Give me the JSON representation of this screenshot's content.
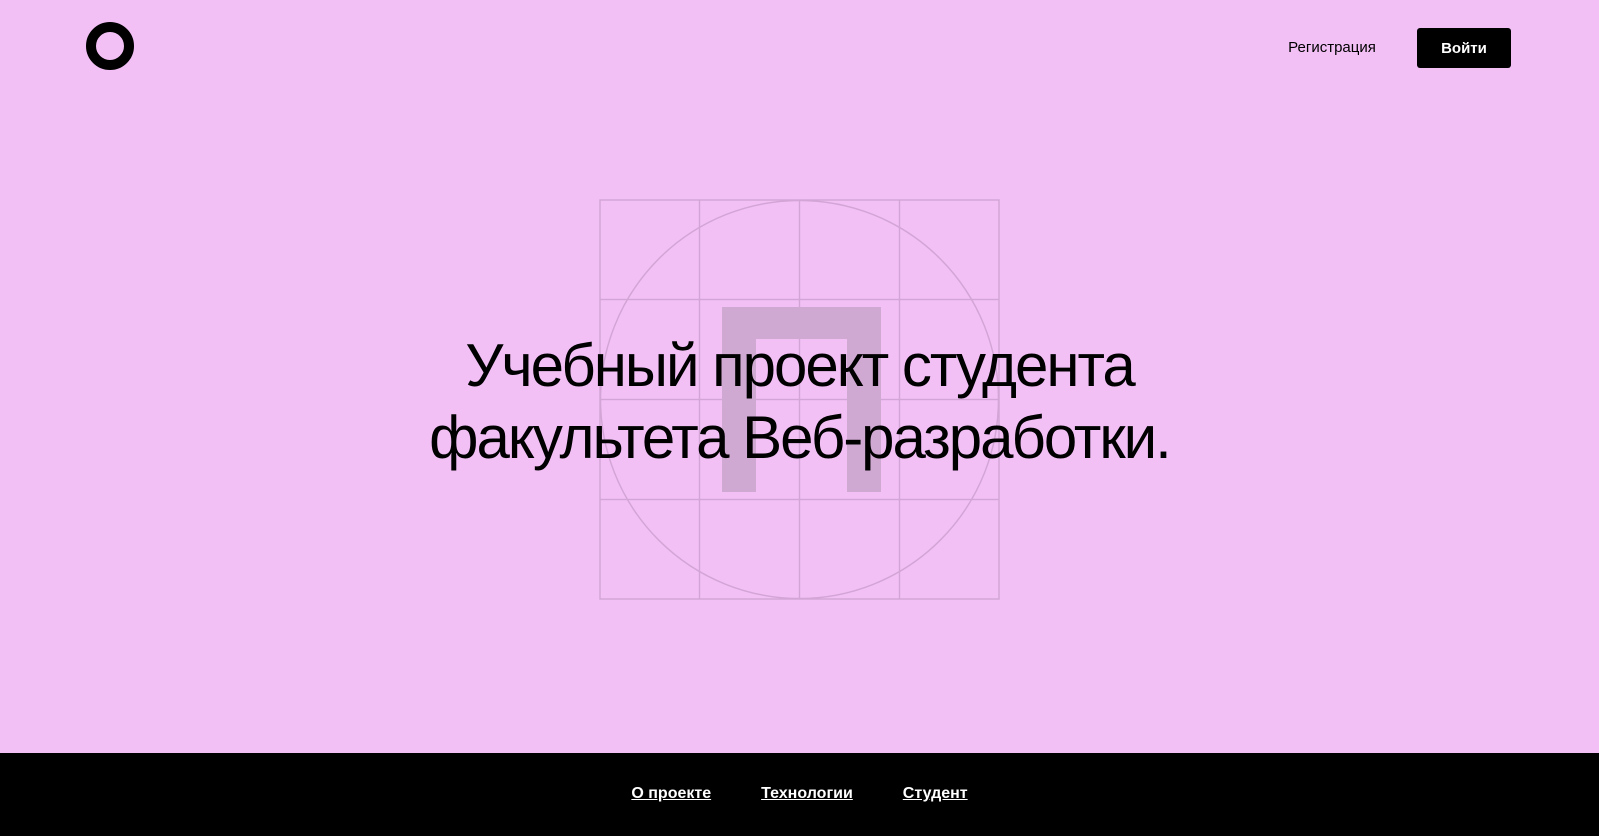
{
  "colors": {
    "hero_background": "#f3c0f6",
    "footer_background": "#000000",
    "text": "#000000",
    "button_background": "#000000",
    "button_text": "#ffffff",
    "graphic_lines": "#d3a5d6",
    "graphic_glyph": "#d0a9d3"
  },
  "header": {
    "logo_icon": "ring-logo-icon",
    "register_label": "Регистрация",
    "login_label": "Войти"
  },
  "promo": {
    "title_line1": "Учебный проект студента",
    "title_line2": "факультета Веб-разработки.",
    "graphic_glyph": "П"
  },
  "footer": {
    "nav": [
      {
        "label": "О проекте"
      },
      {
        "label": "Технологии"
      },
      {
        "label": "Студент"
      }
    ]
  }
}
